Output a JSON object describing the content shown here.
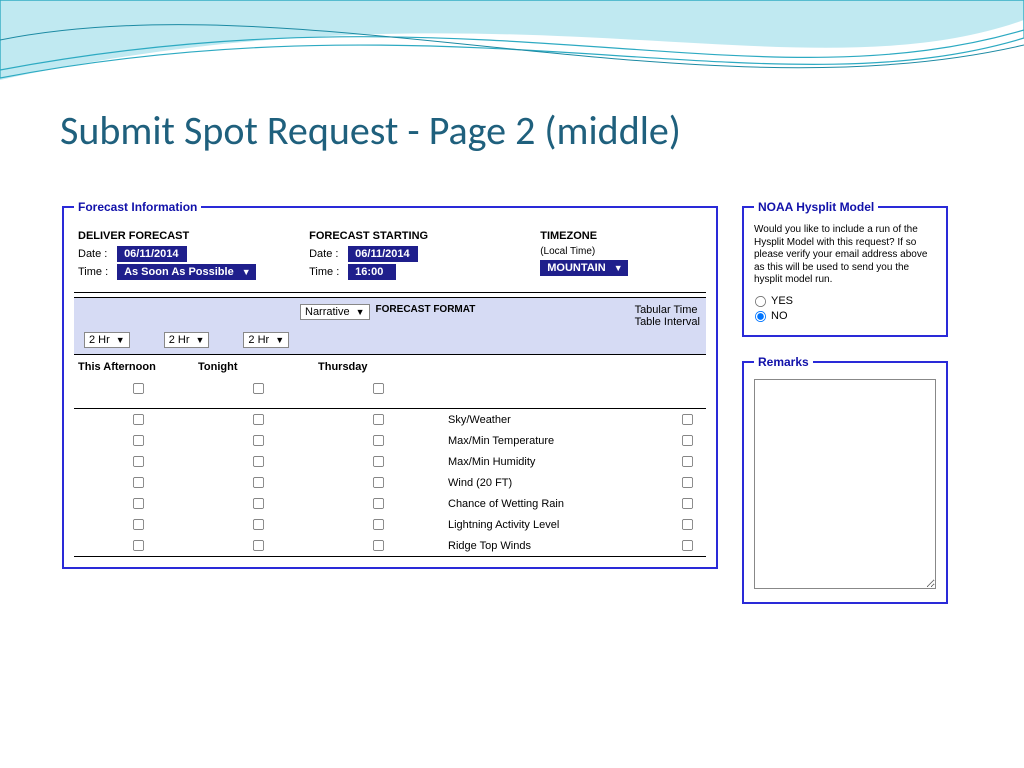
{
  "title": "Submit Spot Request - Page 2 (middle)",
  "forecast_info": {
    "legend": "Forecast Information",
    "deliver": {
      "heading": "DELIVER FORECAST",
      "date_label": "Date :",
      "date_value": "06/11/2014",
      "time_label": "Time :",
      "time_value": "As Soon As Possible"
    },
    "starting": {
      "heading": "FORECAST STARTING",
      "date_label": "Date :",
      "date_value": "06/11/2014",
      "time_label": "Time :",
      "time_value": "16:00"
    },
    "timezone": {
      "heading": "TIMEZONE",
      "note": "(Local Time)",
      "value": "MOUNTAIN"
    },
    "format_select": "Narrative",
    "format_label": "FORECAST FORMAT",
    "hr_options": [
      "2 Hr",
      "2 Hr",
      "2 Hr"
    ],
    "tabular_label1": "Tabular Time",
    "tabular_label2": "Table Interval",
    "periods": [
      "This Afternoon",
      "Tonight",
      "Thursday"
    ],
    "params": [
      "Sky/Weather",
      "Max/Min Temperature",
      "Max/Min Humidity",
      "Wind (20 FT)",
      "Chance of Wetting Rain",
      "Lightning Activity Level",
      "Ridge Top Winds"
    ]
  },
  "hysplit": {
    "legend": "NOAA Hysplit Model",
    "text": "Would you like to include a run of the Hysplit Model with this request? If so please verify your email address above as this will be used to send you the hysplit model run.",
    "yes": "YES",
    "no": "NO"
  },
  "remarks": {
    "legend": "Remarks"
  }
}
